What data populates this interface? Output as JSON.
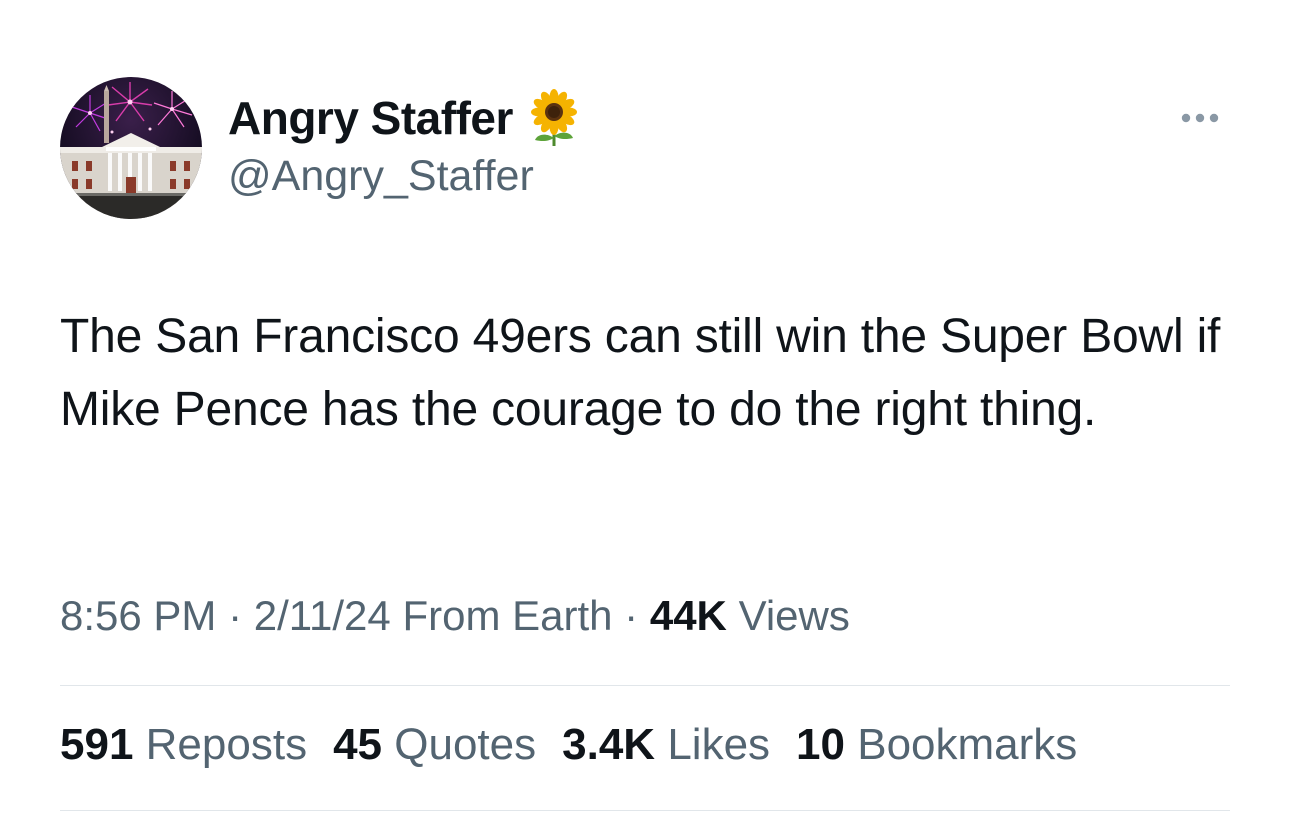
{
  "author": {
    "display_name": "Angry Staffer",
    "handle": "@Angry_Staffer",
    "badge_icon": "sunflower-icon",
    "avatar_icon": "white-house-fireworks-avatar"
  },
  "more_icon": "more-horizontal-icon",
  "tweet": {
    "text": "The San Francisco 49ers can still win the Super Bowl if Mike Pence has the courage to do the right thing."
  },
  "meta": {
    "time": "8:56 PM",
    "sep1": "·",
    "date": "2/11/24",
    "source": "From Earth",
    "sep2": "·",
    "views_count": "44K",
    "views_label": "Views"
  },
  "stats": {
    "reposts": {
      "count": "591",
      "label": "Reposts"
    },
    "quotes": {
      "count": "45",
      "label": "Quotes"
    },
    "likes": {
      "count": "3.4K",
      "label": "Likes"
    },
    "bookmarks": {
      "count": "10",
      "label": "Bookmarks"
    }
  },
  "colors": {
    "primary_text": "#0f1419",
    "secondary_text": "#536471",
    "divider": "#e1e6ea"
  }
}
